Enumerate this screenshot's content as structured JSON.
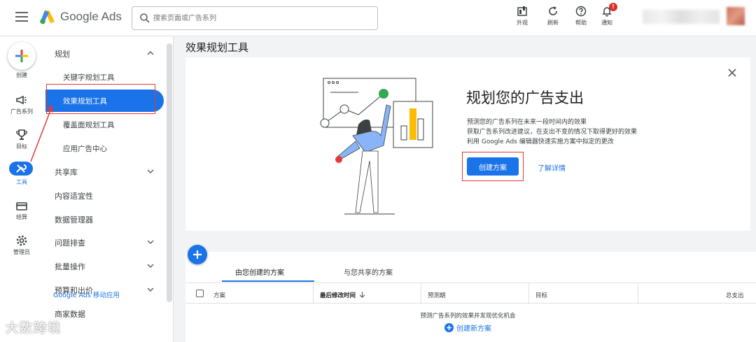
{
  "header": {
    "logo_text": "Google Ads",
    "search_placeholder": "搜索页面或广告系列",
    "buttons": [
      {
        "icon": "appearance-icon",
        "label": "外观"
      },
      {
        "icon": "refresh-icon",
        "label": "刷新"
      },
      {
        "icon": "help-icon",
        "label": "帮助"
      },
      {
        "icon": "bell-icon",
        "label": "通知",
        "badge": "!"
      }
    ]
  },
  "rail": {
    "items": [
      {
        "label": "创建",
        "icon": "plus-icon"
      },
      {
        "label": "广告系列",
        "icon": "megaphone-icon"
      },
      {
        "label": "目标",
        "icon": "trophy-icon"
      },
      {
        "label": "工具",
        "icon": "tools-icon"
      },
      {
        "label": "结算",
        "icon": "card-icon"
      },
      {
        "label": "管理员",
        "icon": "gear-icon"
      }
    ]
  },
  "snav": {
    "section": "规划",
    "sub_items": [
      "关键字规划工具",
      "效果规划工具",
      "覆盖面规划工具",
      "应用广告中心"
    ],
    "groups": [
      "共享库",
      "内容适宜性",
      "数据管理器",
      "问题排查",
      "批量操作",
      "预算和出价",
      "商家数据"
    ],
    "app_link": "Google Ads 移动应用"
  },
  "main": {
    "page_title": "效果规划工具",
    "card": {
      "heading": "规划您的广告支出",
      "lines": [
        "预测您的广告系列在未来一段时间内的效果",
        "获取广告系列改进建议，在支出不变的情况下取得更好的效果",
        "利用 Google Ads 编辑器快速实施方案中拟定的更改"
      ],
      "create_button": "创建方案",
      "learn_more": "了解详情"
    },
    "tabs": [
      "由您创建的方案",
      "与您共享的方案"
    ],
    "columns": [
      "方案",
      "最后修改时间",
      "预测期",
      "目标",
      "总支出"
    ],
    "empty_note": "预测广告系列的效果并发现优化机会",
    "new_plan": "创建新方案"
  },
  "watermark": "大数跨境",
  "colors": {
    "accent": "#1a73e8",
    "highlight": "#e53935"
  }
}
